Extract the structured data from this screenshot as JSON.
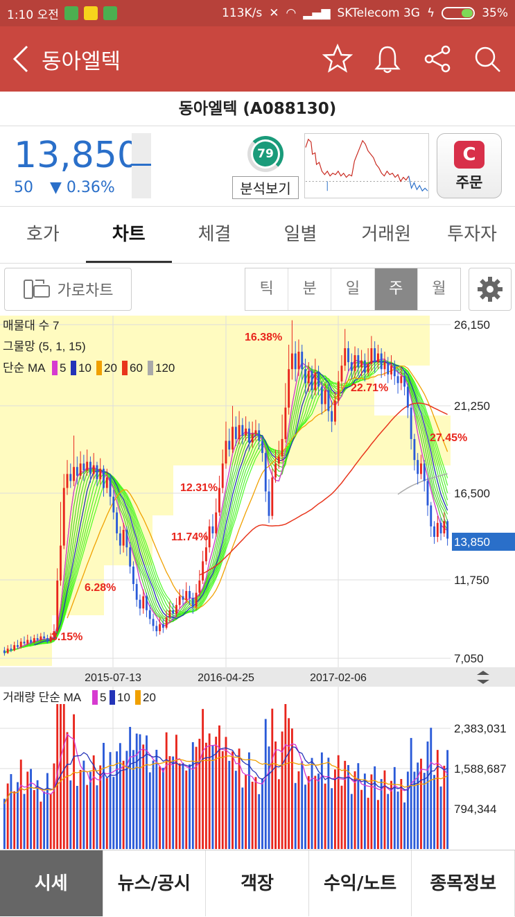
{
  "status": {
    "time": "1:10 오전",
    "speed": "113K/s",
    "carrier": "SKTelecom 3G",
    "battery": "35%"
  },
  "appbar": {
    "title": "동아엘텍",
    "icons": [
      "star-icon",
      "bell-icon",
      "share-icon",
      "search-icon"
    ]
  },
  "stock": {
    "name": "동아엘텍 (A088130)",
    "price": "13,850",
    "change_abs": "50",
    "change_pct": "▼ 0.36%",
    "score": "79",
    "analysis_label": "분석보기",
    "order_logo": "C",
    "order_label": "주문"
  },
  "tabs": [
    "호가",
    "차트",
    "체결",
    "일별",
    "거래원",
    "투자자"
  ],
  "active_tab": "차트",
  "toolbar": {
    "landscape_label": "가로차트",
    "periods": [
      "틱",
      "분",
      "일",
      "주",
      "월"
    ],
    "active_period": "주"
  },
  "chart_data": {
    "type": "candlestick",
    "price_panel": {
      "legend": {
        "line1": "매물대 수 7",
        "line2": "그물망 (5, 1, 15)",
        "ma_prefix": "단순 MA",
        "ma_periods": [
          "5",
          "10",
          "20",
          "60",
          "120"
        ],
        "ma_colors": [
          "#d63ad0",
          "#2434b8",
          "#f0a000",
          "#e8351c",
          "#aaaaaa"
        ]
      },
      "y_ticks": [
        "26,150",
        "21,250",
        "16,500",
        "11,750",
        "7,050"
      ],
      "current_price_label": "13,850",
      "annotations": [
        "16.38%",
        "22.71%",
        "27.45%",
        "12.31%",
        "11.74%",
        "6.28%",
        "3.15%"
      ],
      "x_ticks": [
        "2015-07-13",
        "2016-04-25",
        "2017-02-06"
      ],
      "volume_profile_bands": 7
    },
    "volume_panel": {
      "legend_prefix": "거래량 단순 MA",
      "ma_periods": [
        "5",
        "10",
        "20"
      ],
      "ma_colors": [
        "#d63ad0",
        "#2434b8",
        "#f0a000"
      ],
      "y_ticks": [
        "2,383,031",
        "1,588,687",
        "794,344"
      ]
    },
    "candles": [
      [
        7.5,
        7.35,
        7.7,
        7.2
      ],
      [
        7.35,
        7.6,
        7.8,
        7.3
      ],
      [
        7.6,
        7.5,
        7.85,
        7.4
      ],
      [
        7.5,
        7.8,
        8.0,
        7.45
      ],
      [
        7.8,
        7.7,
        8.1,
        7.6
      ],
      [
        7.7,
        8.0,
        8.2,
        7.6
      ],
      [
        8.0,
        7.9,
        8.3,
        7.8
      ],
      [
        7.9,
        8.1,
        8.4,
        7.8
      ],
      [
        8.1,
        7.95,
        8.3,
        7.85
      ],
      [
        7.95,
        8.2,
        8.4,
        7.9
      ],
      [
        8.2,
        8.1,
        8.45,
        8.0
      ],
      [
        8.1,
        8.3,
        8.5,
        8.0
      ],
      [
        8.3,
        8.2,
        8.55,
        8.1
      ],
      [
        8.2,
        8.0,
        8.4,
        7.9
      ],
      [
        8.0,
        8.3,
        8.5,
        7.95
      ],
      [
        8.3,
        8.6,
        9.0,
        8.2
      ],
      [
        8.6,
        11.5,
        12.2,
        8.5
      ],
      [
        11.5,
        13.5,
        16.0,
        11.2
      ],
      [
        13.5,
        16.8,
        17.6,
        13.3
      ],
      [
        16.8,
        17.6,
        18.4,
        16.4
      ],
      [
        17.6,
        17.2,
        18.2,
        16.8
      ],
      [
        17.2,
        18.0,
        19.8,
        16.9
      ],
      [
        18.0,
        17.5,
        18.6,
        17.0
      ],
      [
        17.5,
        18.2,
        18.9,
        17.3
      ],
      [
        18.2,
        17.8,
        18.7,
        17.2
      ],
      [
        17.8,
        18.3,
        19.0,
        17.5
      ],
      [
        18.3,
        17.6,
        18.6,
        17.1
      ],
      [
        17.6,
        18.1,
        18.8,
        17.3
      ],
      [
        18.1,
        17.3,
        18.3,
        16.9
      ],
      [
        17.3,
        17.9,
        18.5,
        17.0
      ],
      [
        17.9,
        16.8,
        18.1,
        16.3
      ],
      [
        16.8,
        17.4,
        17.9,
        16.5
      ],
      [
        17.4,
        16.3,
        17.6,
        15.8
      ],
      [
        16.3,
        15.4,
        16.7,
        15.0
      ],
      [
        15.4,
        14.2,
        15.7,
        13.8
      ],
      [
        14.2,
        13.5,
        14.6,
        13.0
      ],
      [
        13.5,
        14.4,
        14.8,
        13.1
      ],
      [
        14.4,
        13.4,
        14.6,
        12.9
      ],
      [
        13.4,
        12.3,
        13.7,
        11.9
      ],
      [
        12.3,
        11.3,
        12.6,
        10.9
      ],
      [
        11.3,
        10.4,
        11.6,
        10.0
      ],
      [
        10.4,
        9.9,
        10.7,
        9.5
      ],
      [
        9.9,
        10.6,
        11.0,
        9.6
      ],
      [
        10.6,
        9.8,
        10.8,
        9.4
      ],
      [
        9.8,
        9.3,
        10.1,
        9.0
      ],
      [
        9.3,
        8.9,
        9.6,
        8.6
      ],
      [
        8.9,
        8.6,
        9.2,
        8.3
      ],
      [
        8.6,
        9.0,
        9.4,
        8.4
      ],
      [
        9.0,
        8.8,
        9.3,
        8.5
      ],
      [
        8.8,
        9.4,
        9.8,
        8.7
      ],
      [
        9.4,
        9.8,
        10.3,
        9.1
      ],
      [
        9.8,
        9.6,
        10.2,
        9.2
      ],
      [
        9.6,
        10.1,
        10.5,
        9.4
      ],
      [
        10.1,
        10.6,
        11.0,
        9.9
      ],
      [
        10.6,
        10.4,
        11.0,
        10.1
      ],
      [
        10.4,
        10.9,
        11.4,
        10.2
      ],
      [
        10.9,
        10.5,
        11.2,
        10.1
      ],
      [
        10.5,
        10.0,
        10.8,
        9.6
      ],
      [
        10.0,
        10.8,
        11.3,
        9.8
      ],
      [
        10.8,
        11.5,
        12.1,
        10.6
      ],
      [
        11.5,
        12.6,
        13.2,
        11.3
      ],
      [
        12.6,
        13.4,
        14.3,
        12.4
      ],
      [
        13.4,
        14.6,
        15.0,
        13.1
      ],
      [
        14.6,
        14.2,
        15.3,
        13.9
      ],
      [
        14.2,
        15.4,
        16.2,
        14.0
      ],
      [
        15.4,
        16.8,
        17.5,
        15.2
      ],
      [
        16.8,
        18.2,
        19.0,
        16.5
      ],
      [
        18.2,
        19.5,
        20.6,
        17.9
      ],
      [
        19.5,
        19.0,
        20.2,
        18.6
      ],
      [
        19.0,
        20.3,
        21.5,
        18.8
      ],
      [
        20.3,
        19.6,
        20.9,
        19.2
      ],
      [
        19.6,
        20.4,
        21.2,
        19.3
      ],
      [
        20.4,
        19.8,
        20.8,
        19.3
      ],
      [
        19.8,
        20.2,
        20.9,
        19.5
      ],
      [
        20.2,
        19.4,
        20.6,
        18.9
      ],
      [
        19.4,
        19.9,
        20.6,
        19.1
      ],
      [
        19.9,
        20.1,
        20.7,
        19.5
      ],
      [
        20.1,
        19.5,
        20.5,
        19.0
      ],
      [
        19.5,
        18.8,
        19.8,
        18.3
      ],
      [
        18.8,
        16.6,
        18.9,
        16.0
      ],
      [
        16.6,
        15.2,
        17.3,
        14.8
      ],
      [
        15.2,
        17.4,
        17.9,
        15.0
      ],
      [
        17.4,
        18.2,
        19.0,
        17.1
      ],
      [
        18.2,
        18.6,
        19.5,
        17.9
      ],
      [
        18.6,
        19.6,
        21.0,
        18.3
      ],
      [
        19.6,
        21.4,
        22.8,
        19.4
      ],
      [
        21.4,
        23.6,
        25.0,
        21.0
      ],
      [
        23.6,
        24.5,
        26.4,
        23.0
      ],
      [
        24.5,
        23.6,
        25.2,
        22.9
      ],
      [
        23.6,
        24.6,
        25.3,
        23.2
      ],
      [
        24.6,
        23.6,
        25.0,
        23.0
      ],
      [
        23.6,
        22.8,
        24.2,
        22.2
      ],
      [
        22.8,
        23.5,
        24.0,
        22.3
      ],
      [
        23.5,
        22.4,
        23.8,
        21.9
      ],
      [
        22.4,
        23.4,
        24.2,
        22.1
      ],
      [
        23.4,
        22.6,
        23.8,
        22.1
      ],
      [
        22.6,
        21.6,
        22.9,
        21.0
      ],
      [
        21.6,
        22.4,
        22.8,
        21.2
      ],
      [
        22.4,
        21.2,
        22.7,
        20.6
      ],
      [
        21.2,
        20.6,
        21.8,
        20.0
      ],
      [
        20.6,
        21.8,
        22.3,
        20.4
      ],
      [
        21.8,
        22.9,
        23.5,
        21.5
      ],
      [
        22.9,
        23.8,
        24.4,
        22.5
      ],
      [
        23.8,
        24.8,
        25.9,
        23.5
      ],
      [
        24.8,
        24.0,
        25.2,
        23.5
      ],
      [
        24.0,
        23.5,
        24.5,
        23.0
      ],
      [
        23.5,
        24.4,
        24.9,
        23.1
      ],
      [
        24.4,
        23.7,
        24.8,
        23.2
      ],
      [
        23.7,
        24.1,
        24.7,
        23.2
      ],
      [
        24.1,
        23.4,
        24.5,
        22.9
      ],
      [
        23.4,
        23.9,
        24.8,
        23.2
      ],
      [
        23.9,
        24.8,
        25.5,
        23.5
      ],
      [
        24.8,
        24.0,
        25.2,
        23.4
      ],
      [
        24.0,
        24.5,
        25.0,
        23.6
      ],
      [
        24.5,
        23.6,
        24.8,
        23.1
      ],
      [
        23.6,
        24.0,
        24.6,
        23.2
      ],
      [
        24.0,
        23.3,
        24.3,
        22.8
      ],
      [
        23.3,
        23.8,
        24.4,
        23.0
      ],
      [
        23.8,
        23.2,
        24.1,
        22.7
      ],
      [
        23.2,
        22.8,
        23.6,
        22.2
      ],
      [
        22.8,
        23.2,
        23.7,
        22.4
      ],
      [
        23.2,
        22.6,
        23.5,
        22.1
      ],
      [
        22.6,
        21.4,
        22.8,
        20.8
      ],
      [
        21.4,
        19.6,
        21.6,
        19.0
      ],
      [
        19.6,
        18.4,
        19.9,
        17.8
      ],
      [
        18.4,
        17.6,
        18.8,
        17.0
      ],
      [
        17.6,
        18.2,
        18.7,
        17.3
      ],
      [
        18.2,
        17.2,
        18.4,
        16.6
      ],
      [
        17.2,
        15.8,
        17.4,
        15.2
      ],
      [
        15.8,
        14.6,
        16.0,
        14.0
      ],
      [
        14.6,
        14.0,
        14.9,
        13.6
      ],
      [
        14.0,
        14.8,
        15.2,
        13.7
      ],
      [
        14.8,
        14.2,
        15.1,
        13.8
      ],
      [
        14.2,
        14.9,
        15.4,
        14.0
      ],
      [
        14.9,
        13.9,
        15.0,
        13.5
      ]
    ]
  },
  "bottom_tabs": [
    "시세",
    "뉴스/공시",
    "객장",
    "수익/노트",
    "종목정보"
  ],
  "active_bottom_tab": "시세"
}
